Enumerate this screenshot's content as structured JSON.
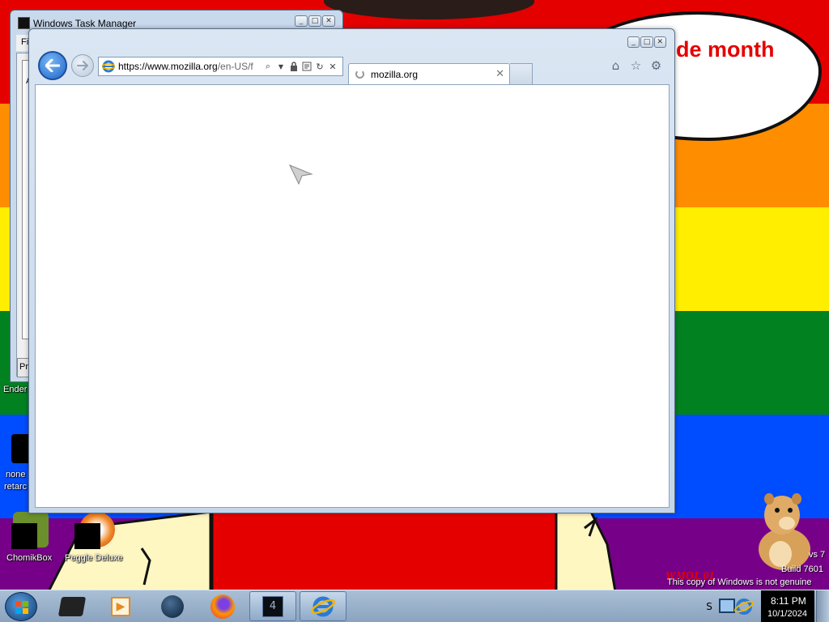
{
  "colors": {
    "red": "#e50000",
    "orange": "#ff8d00",
    "yellow": "#ffee00",
    "green": "#028121",
    "blue": "#004cff",
    "purple": "#770088",
    "accent": "#1e63c9"
  },
  "desktop": {
    "speech_text_line1": "de month",
    "speech_text_line2": "!",
    "left_label_ender": "Ender",
    "left_label_none": "none",
    "left_label_retard": "retarc",
    "icons": [
      {
        "label": "ChomikBox",
        "icon": "chomikbox-icon"
      },
      {
        "label": "Peggle Deluxe",
        "icon": "peggle-icon"
      }
    ],
    "watermark_line1": "vs 7",
    "watermark_line2": "Build 7601",
    "watermark_line3": "This copy of Windows is not genuine"
  },
  "taskmgr": {
    "title": "Windows Task Manager",
    "menu_first": "Fi",
    "tab_letter": "A",
    "proc_button": "Pro"
  },
  "ie": {
    "address_host": "https://www.mozilla.org",
    "address_rest": "/en-US/f",
    "tab_title": "mozilla.org",
    "tools": [
      "home-icon",
      "favorites-star-icon",
      "settings-gear-icon"
    ]
  },
  "taskbar": {
    "items": [
      "explorer",
      "media-player",
      "search",
      "firefox",
      "console",
      "internet-explorer"
    ],
    "tray_text": "S",
    "clock_time": "8:11 PM",
    "clock_date": "10/1/2024"
  }
}
